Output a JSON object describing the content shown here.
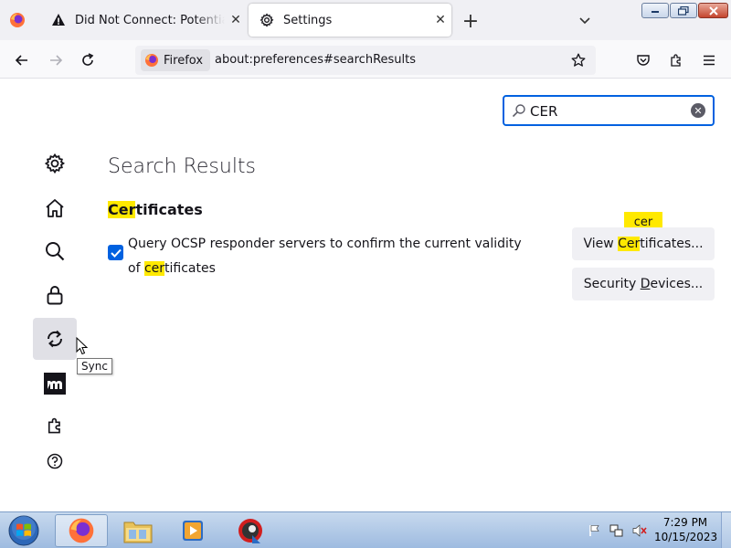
{
  "tabs": [
    {
      "title": "Did Not Connect: Potential Security Issue",
      "icon": "warning-icon"
    },
    {
      "title": "Settings",
      "icon": "gear-icon"
    }
  ],
  "nav": {
    "identity_label": "Firefox",
    "url": "about:preferences#searchResults"
  },
  "search": {
    "value": "CER"
  },
  "sidebar": {
    "tooltip": "Sync",
    "categories": [
      "gear-icon",
      "home-icon",
      "search-icon",
      "lock-icon",
      "sync-icon",
      "mozilla-icon",
      "extensions-icon",
      "help-icon"
    ]
  },
  "results": {
    "heading": "Search Results",
    "group_heading_hl": "Cer",
    "group_heading_rest": "tificates",
    "ocsp_label_main": "Query OCSP responder servers to confirm the current validity of",
    "ocsp_label_hl": "cer",
    "ocsp_label_rest": "tificates",
    "ocsp_checked": true,
    "view_btn_pre": "View ",
    "view_btn_hl": "Cer",
    "view_btn_rest": "tificates...",
    "view_badge": "cer",
    "devices_btn_pre": "Security ",
    "devices_btn_underline": "D",
    "devices_btn_rest": "evices..."
  },
  "taskbar": {
    "time": "7:29 PM",
    "date": "10/15/2023"
  },
  "colors": {
    "accent": "#0061e0",
    "highlight": "#ffe900"
  }
}
